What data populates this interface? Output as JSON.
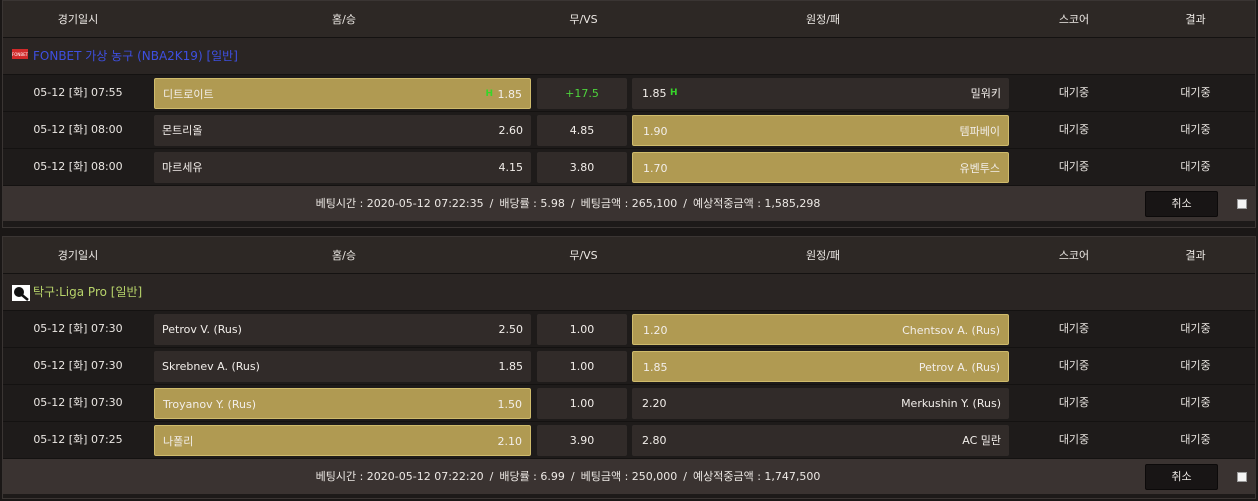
{
  "columns": {
    "time": "경기일시",
    "home": "홈/승",
    "draw": "무/VS",
    "away": "원정/패",
    "score": "스코어",
    "result": "결과"
  },
  "bets": [
    {
      "league": {
        "name": "FONBET 가상 농구 (NBA2K19) [일반]",
        "color": "#3e4fe0",
        "icon": "fonbet-logo-icon",
        "icon_text": "FONBET"
      },
      "matches": [
        {
          "time": "05-12 [화] 07:55",
          "home": "디트로이트",
          "home_odds": "1.85",
          "home_mark": "H",
          "draw": "+17.5",
          "away_odds": "1.85",
          "away_mark": "H",
          "away": "밀워키",
          "selected": "home",
          "score": "대기중",
          "result": "대기중"
        },
        {
          "time": "05-12 [화] 08:00",
          "home": "몬트리올",
          "home_odds": "2.60",
          "home_mark": "",
          "draw": "4.85",
          "away_odds": "1.90",
          "away_mark": "",
          "away": "템파베이",
          "selected": "away",
          "score": "대기중",
          "result": "대기중"
        },
        {
          "time": "05-12 [화] 08:00",
          "home": "마르세유",
          "home_odds": "4.15",
          "home_mark": "",
          "draw": "3.80",
          "away_odds": "1.70",
          "away_mark": "",
          "away": "유벤투스",
          "selected": "away",
          "score": "대기중",
          "result": "대기중"
        }
      ],
      "summary": {
        "bet_time": "베팅시간 : 2020-05-12 07:22:35",
        "odds": "배당률 : 5.98",
        "amount": "베팅금액 : 265,100",
        "expected": "예상적중금액 : 1,585,298"
      },
      "cancel_label": "취소"
    },
    {
      "league": {
        "name": "탁구:Liga Pro [일반]",
        "color": "#b7d36a",
        "icon": "table-tennis-icon",
        "icon_text": ""
      },
      "matches": [
        {
          "time": "05-12 [화] 07:30",
          "home": "Petrov V. (Rus)",
          "home_odds": "2.50",
          "home_mark": "",
          "draw": "1.00",
          "away_odds": "1.20",
          "away_mark": "",
          "away": "Chentsov A. (Rus)",
          "selected": "away",
          "score": "대기중",
          "result": "대기중"
        },
        {
          "time": "05-12 [화] 07:30",
          "home": "Skrebnev A. (Rus)",
          "home_odds": "1.85",
          "home_mark": "",
          "draw": "1.00",
          "away_odds": "1.85",
          "away_mark": "",
          "away": "Petrov A. (Rus)",
          "selected": "away",
          "score": "대기중",
          "result": "대기중"
        },
        {
          "time": "05-12 [화] 07:30",
          "home": "Troyanov Y. (Rus)",
          "home_odds": "1.50",
          "home_mark": "",
          "draw": "1.00",
          "away_odds": "2.20",
          "away_mark": "",
          "away": "Merkushin Y. (Rus)",
          "selected": "home",
          "score": "대기중",
          "result": "대기중"
        },
        {
          "time": "05-12 [화] 07:25",
          "home": "나폴리",
          "home_odds": "2.10",
          "home_mark": "",
          "draw": "3.90",
          "away_odds": "2.80",
          "away_mark": "",
          "away": "AC 밀란",
          "selected": "home",
          "score": "대기중",
          "result": "대기중"
        }
      ],
      "summary": {
        "bet_time": "베팅시간 : 2020-05-12 07:22:20",
        "odds": "배당률 : 6.99",
        "amount": "베팅금액 : 250,000",
        "expected": "예상적중금액 : 1,747,500"
      },
      "cancel_label": "취소"
    }
  ],
  "separator": "/"
}
